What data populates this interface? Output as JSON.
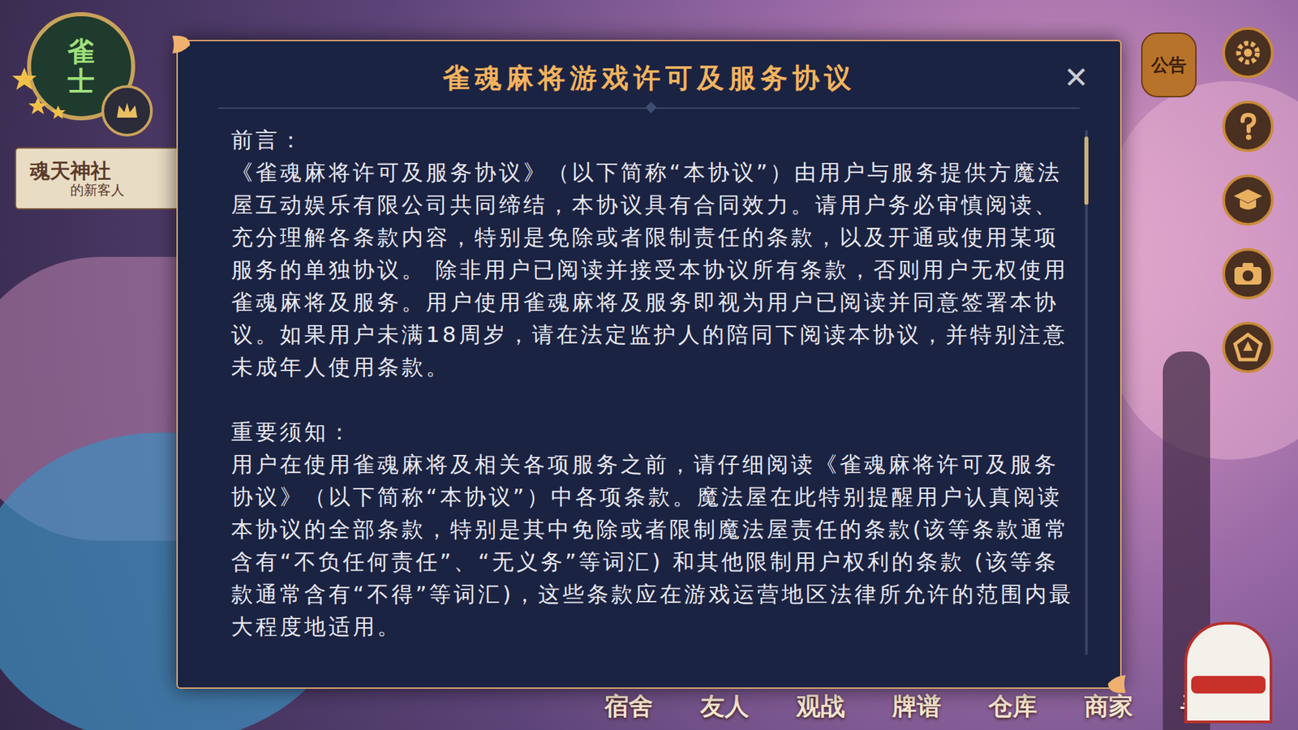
{
  "player": {
    "rank": "雀士",
    "title_line1": "魂天神社",
    "title_line2": "的新客人"
  },
  "announcement": "公告",
  "nav": [
    "宿舍",
    "友人",
    "观战",
    "牌谱",
    "仓库",
    "商家",
    "寻觅"
  ],
  "dialog": {
    "title": "雀魂麻将游戏许可及服务协议",
    "close": "✕",
    "sections": [
      {
        "heading": "前言：",
        "body": "《雀魂麻将许可及服务协议》（以下简称“本协议”）由用户与服务提供方魔法屋互动娱乐有限公司共同缔结，本协议具有合同效力。请用户务必审慎阅读、充分理解各条款内容，特别是免除或者限制责任的条款，以及开通或使用某项服务的单独协议。 除非用户已阅读并接受本协议所有条款，否则用户无权使用雀魂麻将及服务。用户使用雀魂麻将及服务即视为用户已阅读并同意签署本协议。如果用户未满18周岁，请在法定监护人的陪同下阅读本协议，并特别注意未成年人使用条款。"
      },
      {
        "heading": "重要须知：",
        "body": "用户在使用雀魂麻将及相关各项服务之前，请仔细阅读《雀魂麻将许可及服务协议》（以下简称“本协议”）中各项条款。魔法屋在此特别提醒用户认真阅读本协议的全部条款，特别是其中免除或者限制魔法屋责任的条款(该等条款通常含有“不负任何责任”、“无义务”等词汇) 和其他限制用户权利的条款 (该等条款通常含有“不得”等词汇)，这些条款应在游戏运营地区法律所允许的范围内最大程度地适用。"
      }
    ],
    "scrollbar": {
      "level": 0.13
    }
  }
}
